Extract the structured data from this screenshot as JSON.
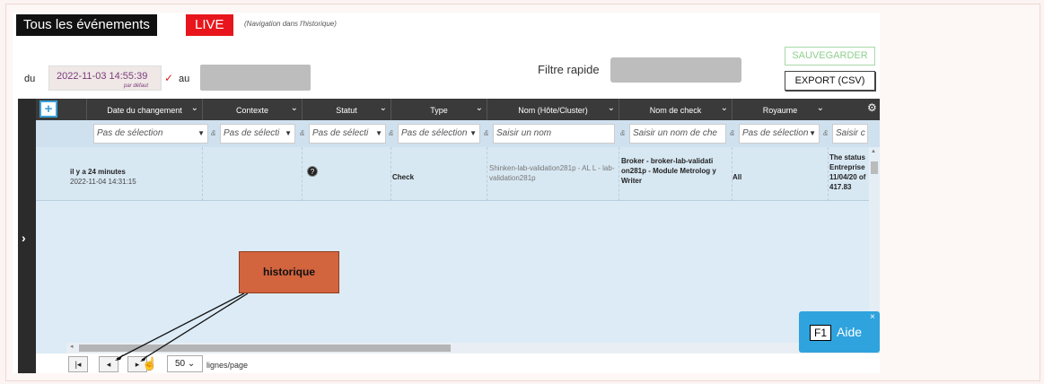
{
  "header": {
    "all_events_label": "Tous les événements",
    "live_label": "LIVE",
    "history_nav_label": "(Navigation dans l'historique)"
  },
  "date_filter": {
    "from_label": "du",
    "from_value": "2022-11-03 14:55:39",
    "from_default_label": "par défaut",
    "to_label": "au",
    "to_value": ""
  },
  "quick_filter": {
    "label": "Filtre rapide",
    "value": ""
  },
  "actions": {
    "save_label": "SAUVEGARDER",
    "export_label": "EXPORT (CSV)"
  },
  "table": {
    "add_label": "+",
    "columns": [
      "Date du changement",
      "Contexte",
      "Statut",
      "Type",
      "Nom (Hôte/Cluster)",
      "Nom de check",
      "Royaume"
    ],
    "filters": [
      "Pas de sélection",
      "Pas de sélecti",
      "Pas de sélecti",
      "Pas de sélection",
      "Saisir un nom",
      "Saisir un nom de che",
      "Pas de sélection",
      "Saisir c"
    ],
    "rows": [
      {
        "relative_time": "il y a 24 minutes",
        "datetime": "2022-11-04 14:31:15",
        "context": "",
        "status_icon": "question-icon",
        "status_symbol": "?",
        "type": "Check",
        "host": "Shinken-lab-validation281p - AL L - lab-validation281p",
        "check": "Broker - broker-lab-validati on281p - Module Metrolog y Writer",
        "realm": "All",
        "output": "The status Entreprise 11/04/20 of 417.83"
      }
    ]
  },
  "pager": {
    "page_size": "50",
    "page_size_suffix": "lignes/page"
  },
  "annotation": {
    "callout_label": "historique"
  },
  "help": {
    "key_label": "F1",
    "label": "Aide",
    "close_symbol": "×"
  },
  "colors": {
    "live": "#e8161c",
    "callout": "#d2643e",
    "help": "#2fa3dd",
    "header": "#3a3a3a"
  }
}
